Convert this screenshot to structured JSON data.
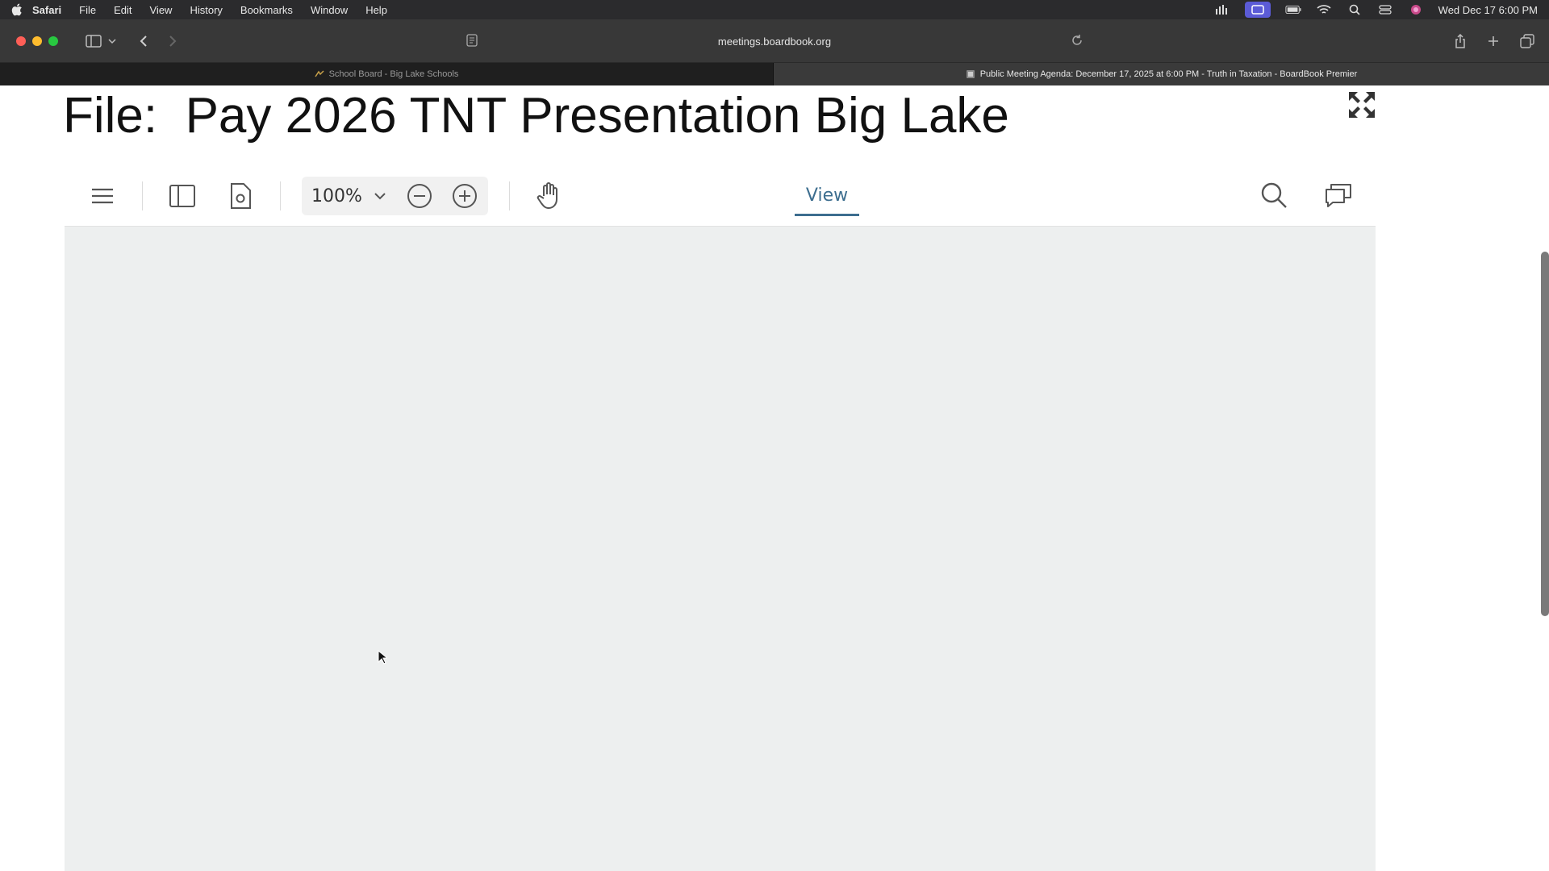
{
  "menubar": {
    "app_name": "Safari",
    "items": [
      "File",
      "Edit",
      "View",
      "History",
      "Bookmarks",
      "Window",
      "Help"
    ],
    "clock": "Wed Dec 17  6:00 PM"
  },
  "browser": {
    "url": "meetings.boardbook.org",
    "tabs": [
      {
        "label": "School Board - Big Lake Schools",
        "active": false
      },
      {
        "label": "Public Meeting Agenda: December 17, 2025 at 6:00 PM - Truth in Taxation - BoardBook Premier",
        "active": true
      }
    ]
  },
  "page": {
    "file_title": "File:  Pay 2026 TNT Presentation Big Lake",
    "viewer": {
      "zoom_value": "100%",
      "view_tab_label": "View"
    }
  }
}
